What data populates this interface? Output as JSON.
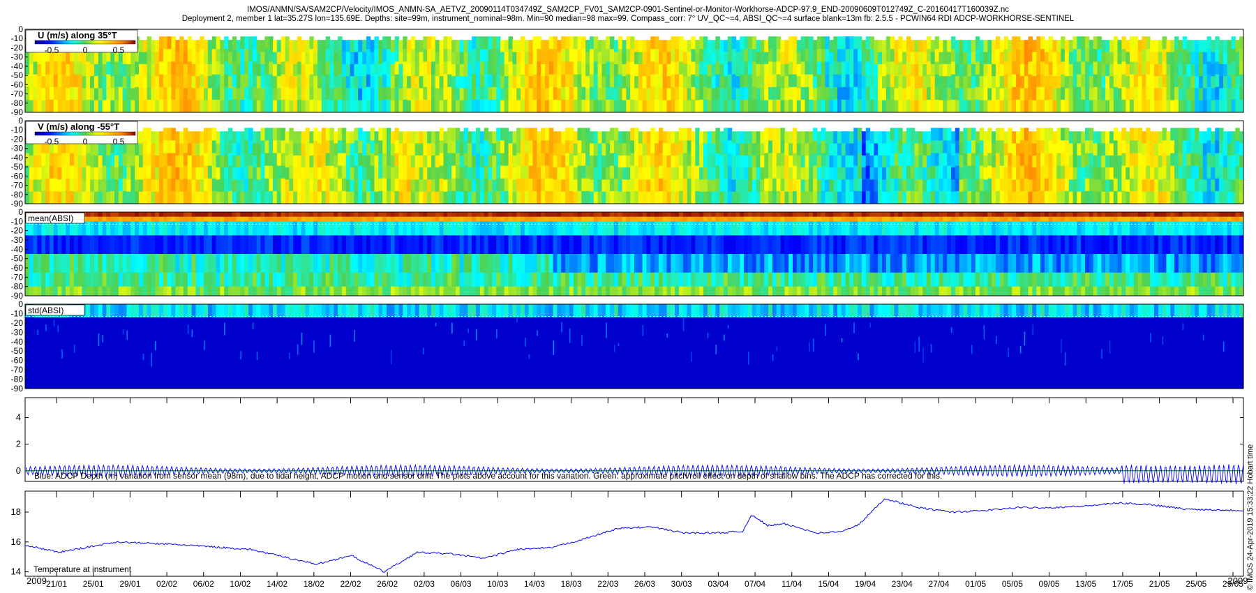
{
  "header": {
    "line1": "IMOS/ANMN/SA/SAM2CP/Velocity/IMOS_ANMN-SA_AETVZ_20090114T034749Z_SAM2CP_FV01_SAM2CP-0901-Sentinel-or-Monitor-Workhorse-ADCP-97.9_END-20090609T012749Z_C-20160417T160039Z.nc",
    "line2": "Deployment 2, member 1 lat=35.27S lon=135.69E. Depths: site=99m, instrument_nominal=98m. Min=90 median=98 max=99. Compass_corr: 7° UV_QC~=4, ABSI_QC~=4 surface blank=13m fb: 2.5.5 - PCWIN64 RDI ADCP-WORKHORSE-SENTINEL"
  },
  "side_label": "© IMOS 24-Apr-2019 15:33:22 Hobart time",
  "colors": {
    "jet_dark_blue": "#00008f",
    "jet_blue": "#0050ff",
    "jet_cyan": "#00e0ff",
    "jet_green": "#5ad24a",
    "jet_yellow": "#f0e020",
    "jet_orange": "#ff8a00",
    "jet_red": "#c00000",
    "depth_line": "#0000ff",
    "pitch_roll_line": "#00a000",
    "temperature_line": "#0000ff"
  },
  "x_axis": {
    "edge_labels": [
      "2009",
      "2009"
    ],
    "ticks": [
      "21/01",
      "25/01",
      "29/01",
      "02/02",
      "06/02",
      "10/02",
      "14/02",
      "18/02",
      "22/02",
      "26/02",
      "02/03",
      "06/03",
      "10/03",
      "14/03",
      "18/03",
      "22/03",
      "26/03",
      "30/03",
      "03/04",
      "07/04",
      "11/04",
      "15/04",
      "19/04",
      "23/04",
      "27/04",
      "01/05",
      "05/05",
      "09/05",
      "13/05",
      "17/05",
      "21/05",
      "25/05",
      "29/05"
    ]
  },
  "chart_data": [
    {
      "type": "heatmap",
      "title": "U (m/s) along 35°T",
      "y_ticks": [
        0,
        -10,
        -20,
        -30,
        -40,
        -50,
        -60,
        -70,
        -80,
        -90
      ],
      "ylim": [
        -90,
        0
      ],
      "colorbar": {
        "ticks": [
          "-0.5",
          "0",
          "0.5"
        ],
        "range": [
          -0.75,
          0.75
        ],
        "colormap": "jet"
      },
      "time_range": [
        "2009-01-14",
        "2009-06-09"
      ]
    },
    {
      "type": "heatmap",
      "title": "V (m/s) along -55°T",
      "y_ticks": [
        0,
        -10,
        -20,
        -30,
        -40,
        -50,
        -60,
        -70,
        -80,
        -90
      ],
      "ylim": [
        -90,
        0
      ],
      "colorbar": {
        "ticks": [
          "-0.5",
          "0",
          "0.5"
        ],
        "range": [
          -0.75,
          0.75
        ],
        "colormap": "jet"
      },
      "time_range": [
        "2009-01-14",
        "2009-06-09"
      ]
    },
    {
      "type": "heatmap",
      "title": "mean(ABSI)",
      "y_ticks": [
        0,
        -10,
        -20,
        -30,
        -40,
        -50,
        -60,
        -70,
        -80,
        -90
      ],
      "ylim": [
        -90,
        0
      ],
      "colormap": "jet",
      "time_range": [
        "2009-01-14",
        "2009-06-09"
      ]
    },
    {
      "type": "heatmap",
      "title": "std(ABSI)",
      "y_ticks": [
        0,
        -10,
        -20,
        -30,
        -40,
        -50,
        -60,
        -70,
        -80,
        -90
      ],
      "ylim": [
        -90,
        0
      ],
      "colormap": "jet",
      "time_range": [
        "2009-01-14",
        "2009-06-09"
      ]
    },
    {
      "type": "line",
      "caption": "Blue: ADCP Depth (m) variation from sensor mean (98m), due to tidal height, ADCP motion and sensor drift. The plots above account for this variation. Green: approximate pitch/roll effect on depth of shallow bins. The ADCP has corrected for this.",
      "y_ticks": [
        "0",
        "2",
        "4"
      ],
      "ylim": [
        -0.8,
        5.5
      ],
      "series": [
        {
          "role": "depth_variation",
          "amplitude": 0.3,
          "period_days": 0.5,
          "late_amplitude": 0.5
        },
        {
          "role": "pitch_roll_effect",
          "level": 0.0
        }
      ],
      "time_range": [
        "2009-01-14",
        "2009-06-09"
      ]
    },
    {
      "type": "line",
      "caption": "Temperature at instrument",
      "y_ticks": [
        "14",
        "16",
        "18"
      ],
      "ylim": [
        13.7,
        19.4
      ],
      "x": [
        "2009-01-14",
        "2009-01-18",
        "2009-01-25",
        "2009-02-02",
        "2009-02-10",
        "2009-02-18",
        "2009-02-22",
        "2009-02-26",
        "2009-03-02",
        "2009-03-06",
        "2009-03-10",
        "2009-03-14",
        "2009-03-18",
        "2009-03-22",
        "2009-03-26",
        "2009-03-30",
        "2009-04-03",
        "2009-04-07",
        "2009-04-10",
        "2009-04-11",
        "2009-04-13",
        "2009-04-15",
        "2009-04-19",
        "2009-04-22",
        "2009-04-24",
        "2009-04-27",
        "2009-05-01",
        "2009-05-05",
        "2009-05-09",
        "2009-05-13",
        "2009-05-17",
        "2009-05-21",
        "2009-05-25",
        "2009-05-29",
        "2009-06-02",
        "2009-06-09"
      ],
      "y": [
        15.8,
        15.3,
        16.0,
        15.8,
        15.5,
        14.5,
        15.1,
        14.0,
        15.3,
        15.2,
        14.9,
        15.5,
        15.6,
        16.2,
        16.9,
        17.0,
        16.6,
        16.6,
        16.7,
        17.8,
        17.1,
        17.2,
        16.6,
        16.7,
        17.2,
        18.9,
        18.3,
        18.0,
        18.1,
        18.3,
        18.3,
        18.4,
        18.6,
        18.5,
        18.2,
        18.1
      ],
      "time_range": [
        "2009-01-14",
        "2009-06-09"
      ]
    }
  ]
}
